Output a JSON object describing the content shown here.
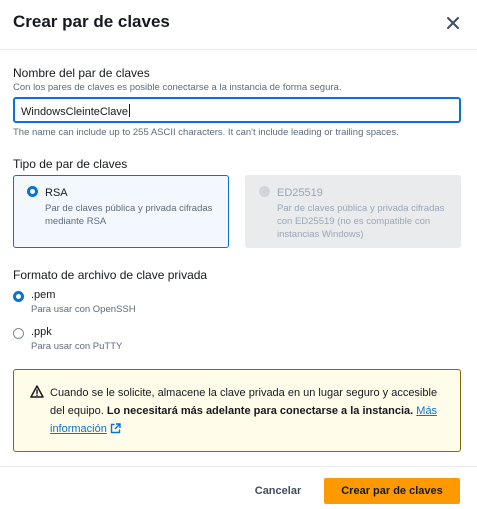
{
  "dialog": {
    "title": "Crear par de claves"
  },
  "key_name": {
    "label": "Nombre del par de claves",
    "description": "Con los pares de claves es posible conectarse a la instancia de forma segura.",
    "value": "WindowsCleinteClave",
    "constraint": "The name can include up to 255 ASCII characters. It can't include leading or trailing spaces."
  },
  "key_type": {
    "label": "Tipo de par de claves",
    "options": [
      {
        "name": "RSA",
        "description": "Par de claves pública y privada cifradas mediante RSA",
        "selected": true,
        "disabled": false
      },
      {
        "name": "ED25519",
        "description": "Par de claves pública y privada cifradas con ED25519 (no es compatible con instancias Windows)",
        "selected": false,
        "disabled": true
      }
    ]
  },
  "file_format": {
    "label": "Formato de archivo de clave privada",
    "options": [
      {
        "name": ".pem",
        "description": "Para usar con OpenSSH",
        "selected": true
      },
      {
        "name": ".ppk",
        "description": "Para usar con PuTTY",
        "selected": false
      }
    ]
  },
  "alert": {
    "text": "Cuando se le solicite, almacene la clave privada en un lugar seguro y accesible del equipo. ",
    "bold": "Lo necesitará más adelante para conectarse a la instancia.",
    "link": "Más información",
    "icon": "warning-icon"
  },
  "footer": {
    "cancel_label": "Cancelar",
    "create_label": "Crear par de claves"
  },
  "colors": {
    "accent": "#0972d3",
    "primary_button": "#ff9900",
    "warning_border": "#8d6605",
    "warning_bg": "#fffce9"
  }
}
